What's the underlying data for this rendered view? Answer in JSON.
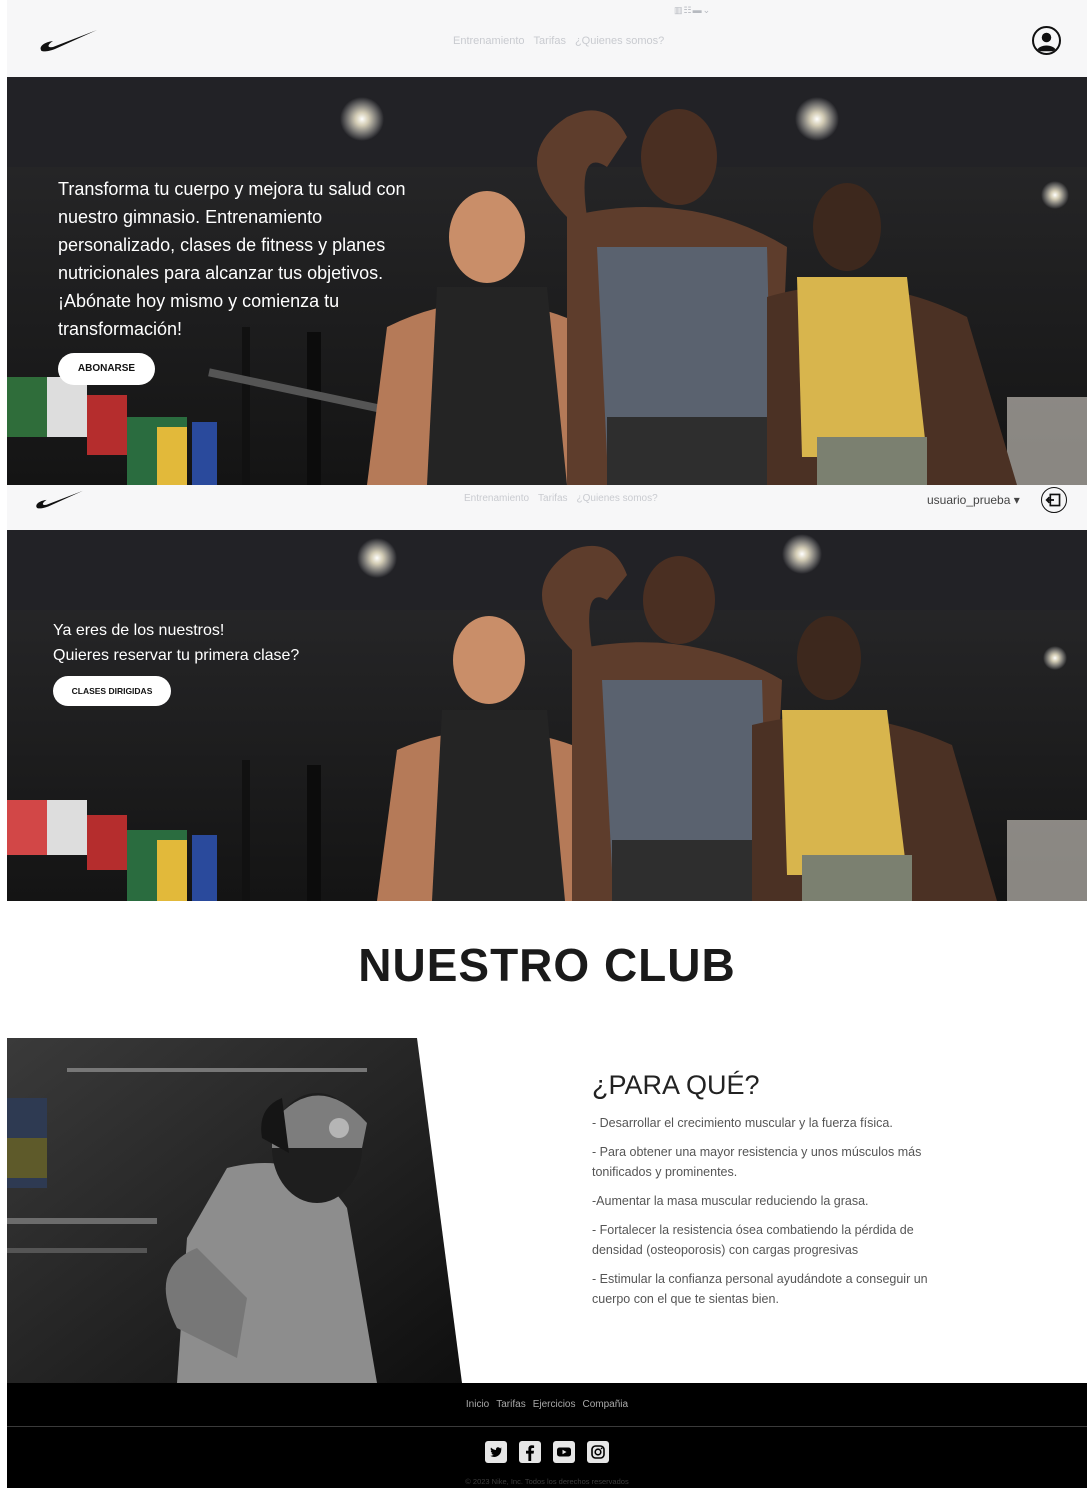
{
  "navbar_top": {
    "links": [
      "Entrenamiento",
      "Tarifas",
      "¿Quienes somos?"
    ],
    "toggler": "▥☷▬⌄"
  },
  "hero_top": {
    "text": "Transforma tu cuerpo y mejora tu salud con nuestro gimnasio. Entrenamiento personalizado, clases de fitness y planes nutricionales para alcanzar tus objetivos. ¡Abónate hoy mismo y comienza tu transformación!",
    "button": "ABONARSE"
  },
  "navbar_logged": {
    "links": [
      "Entrenamiento",
      "Tarifas",
      "¿Quienes somos?"
    ],
    "user": "usuario_prueba ▾"
  },
  "hero_logged": {
    "line1": "Ya eres de los nuestros!",
    "line2": "Quieres reservar tu primera clase?",
    "button": "CLASES DIRIGIDAS"
  },
  "club": {
    "title": "NUESTRO CLUB",
    "heading": "¿PARA QUÉ?",
    "items": [
      "- Desarrollar el crecimiento muscular y la fuerza física.",
      "- Para obtener una mayor resistencia y unos músculos más tonificados y prominentes.",
      "-Aumentar la masa muscular reduciendo la grasa.",
      "- Fortalecer la resistencia ósea combatiendo la pérdida de densidad (osteoporosis) con cargas progresivas",
      "- Estimular la confianza personal ayudándote a conseguir un cuerpo con el que te sientas bien."
    ]
  },
  "footer": {
    "links": [
      "Inicio",
      "Tarifas",
      "Ejercicios",
      "Compañia"
    ],
    "social_icons": [
      "twitter-icon",
      "facebook-icon",
      "youtube-icon",
      "instagram-icon"
    ],
    "copyright": "© 2023 Nike, Inc. Todos los derechos reservados"
  }
}
